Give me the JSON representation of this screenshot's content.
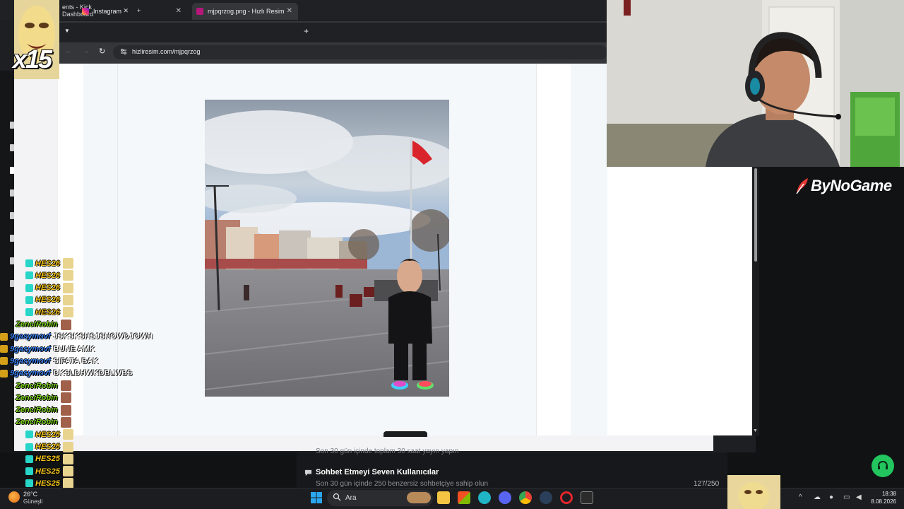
{
  "background_window": {
    "tab_title": "ents - Kick Dashboard",
    "new_tab": "+",
    "close": "✕"
  },
  "browser": {
    "tabs": [
      {
        "label": "Instagram",
        "close": "✕"
      },
      {
        "label": "mjpqrzog.png - Hızlı Resim",
        "close": "✕"
      }
    ],
    "new_tab": "+",
    "url": "hizliresim.com/mjpqrzog",
    "colors": {
      "frame": "#202124",
      "toolbar": "#35363a",
      "instagram": "#e1306c",
      "hizliresim": "#b5177a"
    }
  },
  "kick_page": {
    "dim_text": "Son 30 gün içinde toplam 30 saat yayın yapın",
    "section_title": "Sohbet Etmeyi Seven Kullanıcılar",
    "section_subtitle": "Son 30 gün içinde 250 benzersiz sohbetçiye sahip olun",
    "progress_text": "127/250"
  },
  "overlay": {
    "multiplier": "x15",
    "sponsor": "ByNoGame"
  },
  "chat": {
    "messages": [
      {
        "user": "HES26",
        "color": "#f5c518",
        "badge": "#27d6c8",
        "message": "",
        "emote": true
      },
      {
        "user": "HES26",
        "color": "#f5c518",
        "badge": "#27d6c8",
        "message": "",
        "emote": true
      },
      {
        "user": "HES26",
        "color": "#f5c518",
        "badge": "#27d6c8",
        "message": "",
        "emote": true
      },
      {
        "user": "HES26",
        "color": "#f5c518",
        "badge": "#27d6c8",
        "message": "",
        "emote": true
      },
      {
        "user": "HES26",
        "color": "#f5c518",
        "badge": "#27d6c8",
        "message": "",
        "emote": true
      },
      {
        "user": "ZenciRobin",
        "color": "#7ed321",
        "badge": "",
        "message": "",
        "emote": true
      },
      {
        "user": "9gasymovf",
        "color": "#3b82f6",
        "badge": "#d4a017",
        "message": "JSKSKSHSJSHOWDJOWH",
        "emote": false
      },
      {
        "user": "9gasymovf",
        "color": "#3b82f6",
        "badge": "#d4a017",
        "message": "BUNE AMK",
        "emote": false
      },
      {
        "user": "9gasymovf",
        "color": "#3b82f6",
        "badge": "#d4a017",
        "message": "SIFATA BAK",
        "emote": false
      },
      {
        "user": "9gasymovf",
        "color": "#3b82f6",
        "badge": "#d4a017",
        "message": "DKSLDHWKDBLWBS",
        "emote": false
      },
      {
        "user": "ZenciRobin",
        "color": "#7ed321",
        "badge": "",
        "message": "",
        "emote": true
      },
      {
        "user": "ZenciRobin",
        "color": "#7ed321",
        "badge": "",
        "message": "",
        "emote": true
      },
      {
        "user": "ZenciRobin",
        "color": "#7ed321",
        "badge": "",
        "message": "",
        "emote": true
      },
      {
        "user": "ZenciRobin",
        "color": "#7ed321",
        "badge": "",
        "message": "",
        "emote": true
      },
      {
        "user": "HES25",
        "color": "#f5c518",
        "badge": "#27d6c8",
        "message": "",
        "emote": true
      },
      {
        "user": "HES25",
        "color": "#f5c518",
        "badge": "#27d6c8",
        "message": "",
        "emote": true
      },
      {
        "user": "HES25",
        "color": "#f5c518",
        "badge": "#27d6c8",
        "message": "",
        "emote": true
      },
      {
        "user": "HES25",
        "color": "#f5c518",
        "badge": "#27d6c8",
        "message": "",
        "emote": true
      },
      {
        "user": "HES25",
        "color": "#f5c518",
        "badge": "#27d6c8",
        "message": "",
        "emote": true
      }
    ]
  },
  "taskbar": {
    "weather_temp": "26°C",
    "weather_desc": "Güneşli",
    "search_placeholder": "Ara",
    "time": "18:38",
    "date": "8.08.2026",
    "tray_chevron": "^",
    "apps": [
      "file-explorer",
      "store",
      "edge",
      "discord",
      "chrome",
      "steam",
      "opera-gx",
      "epic-games"
    ]
  }
}
